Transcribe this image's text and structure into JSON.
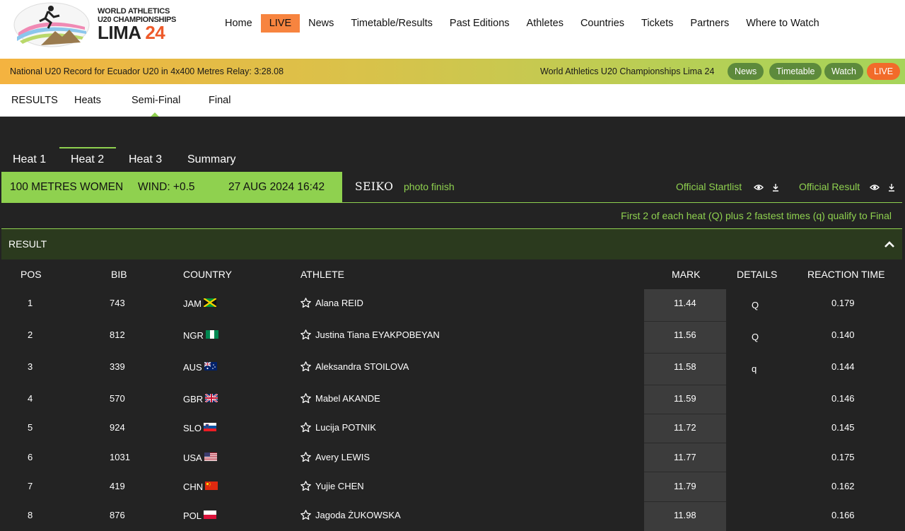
{
  "logo": {
    "line1": "WORLD ATHLETICS",
    "line2": "U20 CHAMPIONSHIPS",
    "word": "LIMA",
    "num": "24"
  },
  "nav": [
    "Home",
    "LIVE",
    "News",
    "Timetable/Results",
    "Past Editions",
    "Athletes",
    "Countries",
    "Tickets",
    "Partners",
    "Where to Watch"
  ],
  "ticker": {
    "left_text": "National U20 Record for Ecuador U20 in 4x400 Metres Relay: 3:28.08",
    "right_text": "World Athletics U20 Championships Lima 24",
    "pills": [
      "News",
      "Timetable",
      "Watch",
      "LIVE"
    ]
  },
  "subnav": {
    "label": "RESULTS",
    "items": [
      "Heats",
      "Semi-Final",
      "Final"
    ]
  },
  "heat_tabs": [
    "Heat 1",
    "Heat 2",
    "Heat 3",
    "Summary"
  ],
  "event": {
    "name": "100 METRES WOMEN",
    "wind": "WIND: +0.5",
    "datetime": "27 AUG 2024 16:42"
  },
  "seiko": "SEIKO",
  "photo_finish": "photo finish",
  "links": {
    "startlist": "Official Startlist",
    "result": "Official Result"
  },
  "qualify_text": "First 2 of each heat (Q) plus 2 fastest times (q) qualify to Final",
  "result_title": "RESULT",
  "columns": {
    "pos": "POS",
    "bib": "BIB",
    "country": "COUNTRY",
    "athlete": "ATHLETE",
    "mark": "MARK",
    "details": "DETAILS",
    "reaction": "REACTION TIME"
  },
  "rows": [
    {
      "pos": "1",
      "bib": "743",
      "country": "JAM",
      "athlete": "Alana REID",
      "mark": "11.44",
      "details": "Q",
      "reaction": "0.179"
    },
    {
      "pos": "2",
      "bib": "812",
      "country": "NGR",
      "athlete": "Justina Tiana EYAKPOBEYAN",
      "mark": "11.56",
      "details": "Q",
      "reaction": "0.140"
    },
    {
      "pos": "3",
      "bib": "339",
      "country": "AUS",
      "athlete": "Aleksandra STOILOVA",
      "mark": "11.58",
      "details": "q",
      "reaction": "0.144"
    },
    {
      "pos": "4",
      "bib": "570",
      "country": "GBR",
      "athlete": "Mabel AKANDE",
      "mark": "11.59",
      "details": "",
      "reaction": "0.146"
    },
    {
      "pos": "5",
      "bib": "924",
      "country": "SLO",
      "athlete": "Lucija POTNIK",
      "mark": "11.72",
      "details": "",
      "reaction": "0.145"
    },
    {
      "pos": "6",
      "bib": "1031",
      "country": "USA",
      "athlete": "Avery LEWIS",
      "mark": "11.77",
      "details": "",
      "reaction": "0.175"
    },
    {
      "pos": "7",
      "bib": "419",
      "country": "CHN",
      "athlete": "Yujie CHEN",
      "mark": "11.79",
      "details": "",
      "reaction": "0.162"
    },
    {
      "pos": "8",
      "bib": "876",
      "country": "POL",
      "athlete": "Jagoda ŻUKOWSKA",
      "mark": "11.98",
      "details": "",
      "reaction": "0.166"
    }
  ],
  "colors": {
    "accent_green": "#8fd14f",
    "live_orange": "#f7843f",
    "dark_bg": "#232323",
    "mark_bg": "#3c3c3c"
  }
}
